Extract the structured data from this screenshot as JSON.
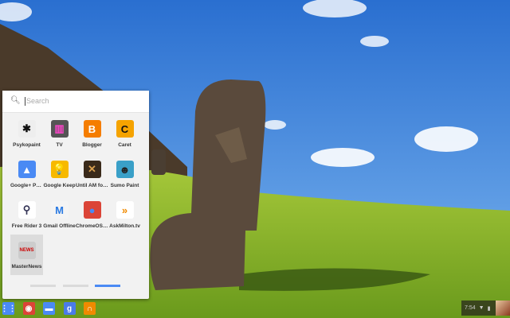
{
  "search": {
    "placeholder": "Search",
    "icon": "search-icon"
  },
  "apps": [
    {
      "label": "Psykopaint",
      "color": "#eeeeee",
      "glyph": "✱",
      "fg": "#111"
    },
    {
      "label": "TV",
      "color": "#555555",
      "glyph": "▥",
      "fg": "#f4c"
    },
    {
      "label": "Blogger",
      "color": "#f57d00",
      "glyph": "B",
      "fg": "#fff"
    },
    {
      "label": "Caret",
      "color": "#f5a300",
      "glyph": "C",
      "fg": "#111"
    },
    {
      "label": "Google+ Pho...",
      "color": "#4a8af4",
      "glyph": "▲",
      "fg": "#fff"
    },
    {
      "label": "Google Keep",
      "color": "#f7b900",
      "glyph": "💡",
      "fg": "#fff"
    },
    {
      "label": "Until AM for ...",
      "color": "#3a2a1a",
      "glyph": "✕",
      "fg": "#d9a050"
    },
    {
      "label": "Sumo Paint",
      "color": "#3aa0c8",
      "glyph": "☻",
      "fg": "#222"
    },
    {
      "label": "Free Rider 3",
      "color": "#ffffff",
      "glyph": "⚲",
      "fg": "#335"
    },
    {
      "label": "Gmail Offline",
      "color": "#f4f4f4",
      "glyph": "M",
      "fg": "#2a7ae2"
    },
    {
      "label": "ChromeOS V...",
      "color": "#db4437",
      "glyph": "●",
      "fg": "#4a8af4"
    },
    {
      "label": "AskMilton.tv",
      "color": "#ffffff",
      "glyph": "»",
      "fg": "#f08a00"
    },
    {
      "label": "MasterNews",
      "color": "#cccccc",
      "glyph": "NEWS",
      "fg": "#c00"
    }
  ],
  "pages": {
    "count": 3,
    "active": 3
  },
  "shelf": [
    {
      "name": "app-launcher-button",
      "color": "#4a8af4",
      "glyph": "⋮⋮"
    },
    {
      "name": "chrome-browser-icon",
      "color": "#db4437",
      "glyph": "◉"
    },
    {
      "name": "files-app-icon",
      "color": "#4a8af4",
      "glyph": "▬"
    },
    {
      "name": "google-search-icon",
      "color": "#4a7be8",
      "glyph": "g"
    },
    {
      "name": "google-play-music-icon",
      "color": "#f08a00",
      "glyph": "∩"
    }
  ],
  "tray": {
    "time": "7:54"
  }
}
